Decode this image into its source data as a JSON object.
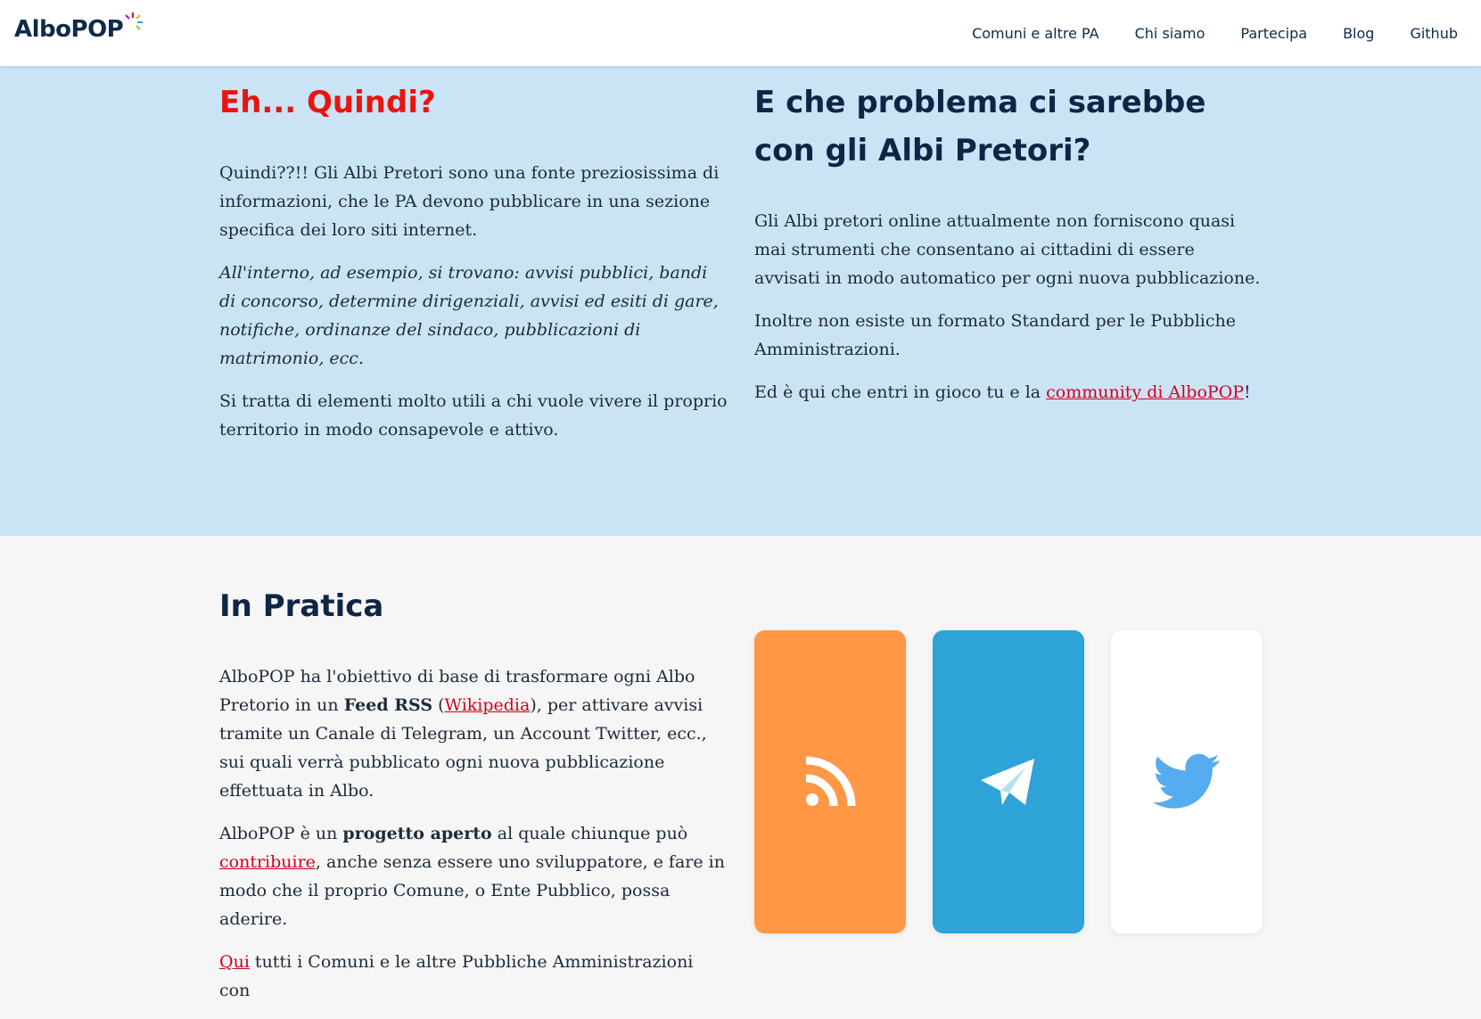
{
  "header": {
    "logo_text": "AlboPOP",
    "nav": [
      "Comuni e altre PA",
      "Chi siamo",
      "Partecipa",
      "Blog",
      "Github"
    ]
  },
  "section_blue": {
    "left": {
      "title": "Eh... Quindi?",
      "p1": "Quindi??!! Gli Albi Pretori sono una fonte preziosissima di informazioni, che le PA devono pubblicare in una sezione specifica dei loro siti internet.",
      "p2": "All'interno, ad esempio, si trovano: avvisi pubblici, bandi di concorso, determine dirigenziali, avvisi ed esiti di gare, notifiche, ordinanze del sindaco, pubblicazioni di matrimonio, ecc.",
      "p3": "Si tratta di elementi molto utili a chi vuole vivere il proprio territorio in modo consapevole e attivo."
    },
    "right": {
      "title": "E che problema ci sarebbe con gli Albi Pretori?",
      "p1": "Gli Albi pretori online attualmente non forniscono quasi mai strumenti che consentano ai cittadini di essere avvisati in modo automatico per ogni nuova pubblicazione.",
      "p2": "Inoltre non esiste un formato Standard per le Pubbliche Amministrazioni.",
      "p3_before": "Ed è qui che entri in gioco tu e la ",
      "p3_link": "community di AlboPOP",
      "p3_after": "!"
    }
  },
  "section_gray": {
    "title": "In Pratica",
    "p1_a": "AlboPOP ha l'obiettivo di base di trasformare ogni Albo Pretorio in un ",
    "p1_bold": "Feed RSS",
    "p1_b": " (",
    "p1_link": "Wikipedia",
    "p1_c": "), per attivare avvisi tramite un Canale di Telegram, un Account Twitter, ecc., sui quali verrà pubblicato ogni nuova pubblicazione effettuata in Albo.",
    "p2_a": "AlboPOP è un ",
    "p2_bold": "progetto aperto",
    "p2_b": " al quale chiunque può ",
    "p2_link": "contribuire",
    "p2_c": ", anche senza essere uno sviluppatore, e fare in modo che il proprio Comune, o Ente Pubblico, possa aderire.",
    "p3_link": "Qui",
    "p3_rest": " tutti i Comuni e le altre Pubbliche Amministrazioni con"
  },
  "cards": [
    {
      "icon": "rss-icon",
      "color": "#ff9745"
    },
    {
      "icon": "telegram-icon",
      "color": "#2ea3d7"
    },
    {
      "icon": "twitter-icon",
      "color": "#ffffff"
    }
  ],
  "colors": {
    "accent_red": "#e8150f",
    "navy": "#0f2545",
    "blue_bg": "#cae4f6"
  }
}
